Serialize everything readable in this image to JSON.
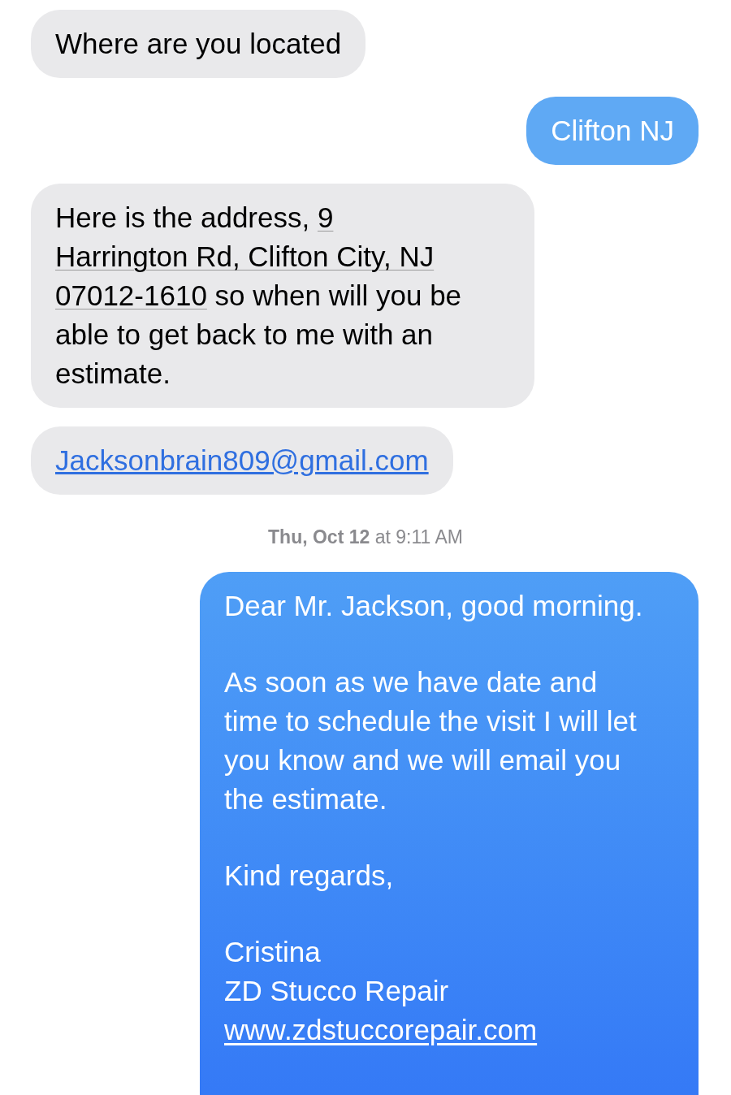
{
  "messages": [
    {
      "kind": "received",
      "parts": [
        {
          "text": "Where are you located",
          "link": false
        }
      ]
    },
    {
      "kind": "sent",
      "paragraphs": [
        {
          "lines": [
            {
              "text": "Clifton NJ",
              "link": false
            }
          ]
        }
      ]
    },
    {
      "kind": "received",
      "parts": [
        {
          "text": "Here is the address, ",
          "link": false
        },
        {
          "text": "9",
          "link": true
        },
        {
          "text": "Harrington Rd, Clifton City, NJ",
          "link": true
        },
        {
          "text": "07012-1610",
          "link": true
        },
        {
          "text": " so when will you be able to get back to me with an estimate.",
          "link": false
        }
      ]
    },
    {
      "kind": "received",
      "parts": [
        {
          "text": "Jacksonbrain809@gmail.com",
          "link": true
        }
      ]
    },
    {
      "kind": "timestamp",
      "text": "**Thu, Oct 12** at 9:11 AM"
    },
    {
      "kind": "sent",
      "paragraphs": [
        {
          "lines": [
            {
              "text": "Dear Mr. Jackson, good morning.",
              "link": false
            }
          ]
        },
        {
          "lines": [
            {
              "text": "As soon as we have date and time to schedule the visit I will let you know and we will email you the estimate.",
              "link": false
            }
          ]
        },
        {
          "lines": [
            {
              "text": "Kind regards,",
              "link": false
            }
          ]
        },
        {
          "lines": [
            {
              "text": "Cristina",
              "link": false
            },
            {
              "text": "ZD Stucco Repair",
              "link": false
            },
            {
              "text": "www.zdstuccorepair.com",
              "link": true
            }
          ]
        }
      ]
    }
  ]
}
